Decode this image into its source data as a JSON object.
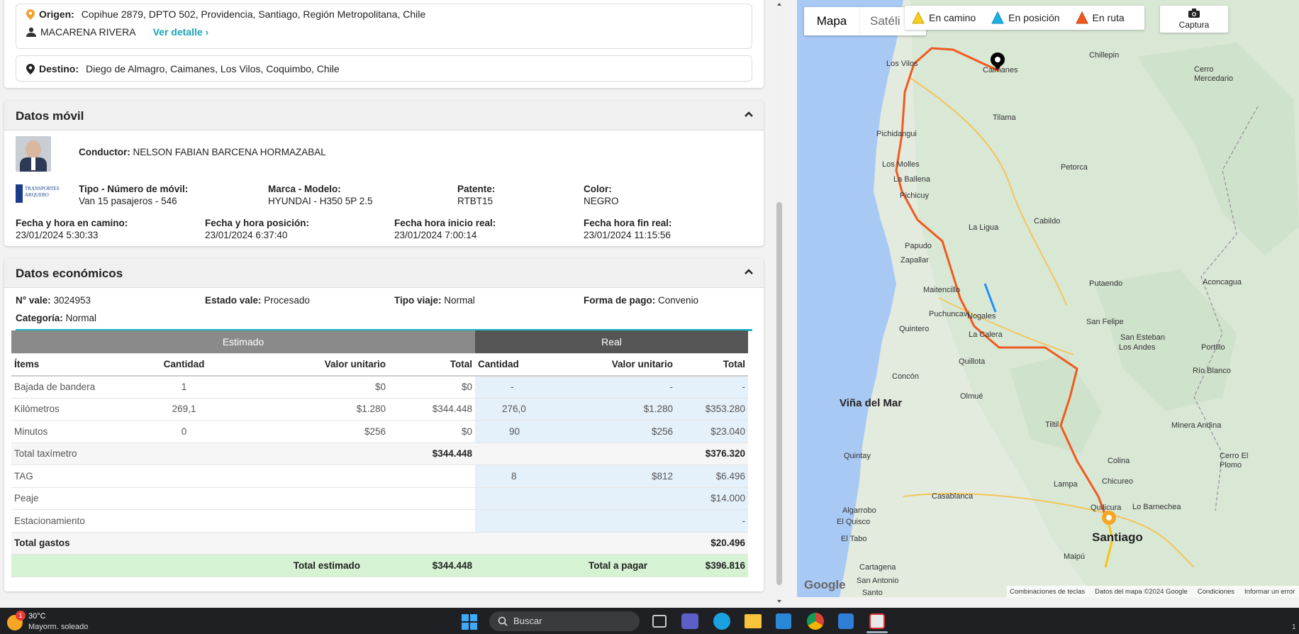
{
  "route": {
    "origin_label": "Origen:",
    "origin_value": "Copihue 2879, DPTO 502, Providencia, Santiago, Región Metropolitana, Chile",
    "passenger": "MACARENA RIVERA",
    "detail_link": "Ver detalle",
    "destination_label": "Destino:",
    "destination_value": "Diego de Almagro, Caimanes, Los Vilos, Coquimbo, Chile"
  },
  "mobile": {
    "title": "Datos móvil",
    "driver_label": "Conductor:",
    "driver_value": "NELSON FABIAN BARCENA HORMAZABAL",
    "type_label": "Tipo - Número de móvil:",
    "type_value": "Van 15 pasajeros - 546",
    "brand_label": "Marca - Modelo:",
    "brand_value": "HYUNDAI - H350 5P 2.5",
    "plate_label": "Patente:",
    "plate_value": "RTBT15",
    "color_label": "Color:",
    "color_value": "NEGRO",
    "enroute_label": "Fecha y hora en camino:",
    "enroute_value": "23/01/2024 5:30:33",
    "position_label": "Fecha y hora posición:",
    "position_value": "23/01/2024 6:37:40",
    "start_label": "Fecha hora inicio real:",
    "start_value": "23/01/2024 7:00:14",
    "end_label": "Fecha hora fin real:",
    "end_value": "23/01/2024 11:15:56",
    "logo_text": "TRANSPORTES ARQUERO"
  },
  "economic": {
    "title": "Datos económicos",
    "voucher_label": "N° vale:",
    "voucher_value": "3024953",
    "state_label": "Estado vale:",
    "state_value": "Procesado",
    "trip_label": "Tipo viaje:",
    "trip_value": "Normal",
    "payment_label": "Forma de pago:",
    "payment_value": "Convenio",
    "category_label": "Categoría:",
    "category_value": "Normal",
    "estimated_header": "Estimado",
    "real_header": "Real",
    "columns": [
      "Ítems",
      "Cantidad",
      "Valor unitario",
      "Total",
      "Cantidad",
      "Valor unitario",
      "Total"
    ],
    "rows": [
      [
        "Bajada de bandera",
        "1",
        "$0",
        "$0",
        "-",
        "-",
        "-"
      ],
      [
        "Kilómetros",
        "269,1",
        "$1.280",
        "$344.448",
        "276,0",
        "$1.280",
        "$353.280"
      ],
      [
        "Minutos",
        "0",
        "$256",
        "$0",
        "90",
        "$256",
        "$23.040"
      ]
    ],
    "taximeter_label": "Total taxímetro",
    "taximeter_est": "$344.448",
    "taximeter_real": "$376.320",
    "extras": [
      [
        "TAG",
        "8",
        "$812",
        "$6.496"
      ],
      [
        "Peaje",
        "",
        "",
        "$14.000"
      ],
      [
        "Estacionamiento",
        "",
        "",
        "-"
      ]
    ],
    "expenses_label": "Total gastos",
    "expenses_value": "$20.496",
    "total_est_label": "Total estimado",
    "total_est_value": "$344.448",
    "total_pay_label": "Total a pagar",
    "total_pay_value": "$396.816"
  },
  "map": {
    "tab_map": "Mapa",
    "tab_sat": "Satéli",
    "legend_camino": "En camino",
    "legend_posicion": "En posición",
    "legend_ruta": "En ruta",
    "capture": "Captura",
    "places": [
      "Chillepin",
      "Los Vilos",
      "Caimanes",
      "Cerro Mercedario",
      "Tilama",
      "Pichidangui",
      "Petorca",
      "Los Molles",
      "La Ballena",
      "Pichicuy",
      "La Ligua",
      "Cabildo",
      "Papudo",
      "Zapallar",
      "Putaendo",
      "Aconcagua",
      "Maitencillo",
      "Puchuncaví",
      "Nogales",
      "San Felipe",
      "Quintero",
      "La Calera",
      "San Esteban",
      "Los Andes",
      "Portillo",
      "Quillota",
      "Concón",
      "Río Blanco",
      "Viña del Mar",
      "Olmué",
      "Tiltil",
      "Minera Andina",
      "Quintay",
      "Colina",
      "Cerro El Plomo",
      "Lampa",
      "Chicureo",
      "Casablanca",
      "Quilicura",
      "Lo Barnechea",
      "Algarrobo",
      "El Quisco",
      "Santiago",
      "El Tabo",
      "Maipú",
      "Cartagena",
      "San Antonio",
      "Santo",
      "Google"
    ],
    "footer_items": [
      "Combinaciones de teclas",
      "Datos del mapa ©2024 Google",
      "Condiciones",
      "Informar un error"
    ]
  },
  "taskbar": {
    "temp": "30°C",
    "weather": "Mayorm. soleado",
    "badge": "1",
    "search": "Buscar",
    "corner": "1"
  }
}
